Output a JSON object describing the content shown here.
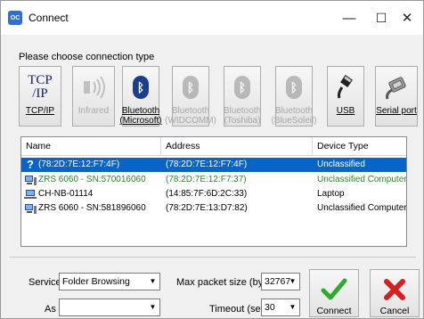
{
  "window": {
    "title": "Connect",
    "icon_text": "OC",
    "minimize_glyph": "—",
    "maximize_glyph": "☐",
    "close_glyph": "✕"
  },
  "prompt": "Please choose connection type",
  "connection_types": [
    {
      "label": "TCP/IP",
      "icon": "tcpip-icon",
      "glyph": "TCP\n/IP",
      "enabled": true
    },
    {
      "label": "Infrared",
      "icon": "infrared-icon",
      "enabled": false
    },
    {
      "label": "Bluetooth\n(Microsoft)",
      "icon": "bluetooth-icon",
      "enabled": true
    },
    {
      "label": "Bluetooth\n(WIDCOMM)",
      "icon": "bluetooth-icon",
      "enabled": false
    },
    {
      "label": "Bluetooth\n(Toshiba)",
      "icon": "bluetooth-icon",
      "enabled": false
    },
    {
      "label": "Bluetooth\n(BlueSoleil)",
      "icon": "bluetooth-icon",
      "enabled": false
    },
    {
      "label": "USB",
      "icon": "usb-icon",
      "enabled": true
    },
    {
      "label": "Serial port",
      "icon": "serial-port-icon",
      "enabled": true
    }
  ],
  "device_list": {
    "columns": [
      "Name",
      "Address",
      "Device Type"
    ],
    "rows": [
      {
        "icon": "question-icon",
        "name": "(78:2D:7E:12:F7:4F)",
        "address": "(78:2D:7E:12:F7:4F)",
        "type": "Unclassified",
        "selected": true,
        "green": false
      },
      {
        "icon": "computer-icon",
        "name": "ZRS 6060 - SN:570016060",
        "address": "(78:2D:7E:12:F7:37)",
        "type": "Unclassified Computer",
        "selected": false,
        "green": true
      },
      {
        "icon": "laptop-icon",
        "name": "CH-NB-01114",
        "address": "(14:85:7F:6D:2C:33)",
        "type": "Laptop",
        "selected": false,
        "green": false
      },
      {
        "icon": "computer-icon",
        "name": "ZRS 6060 - SN:581896060",
        "address": "(78:2D:7E:13:D7:82)",
        "type": "Unclassified Computer",
        "selected": false,
        "green": false
      }
    ]
  },
  "service": {
    "label": "Service",
    "value": "Folder Browsing"
  },
  "as_field": {
    "label": "As",
    "value": ""
  },
  "max_packet": {
    "label": "Max packet size (bytes)",
    "value": "32767"
  },
  "timeout": {
    "label": "Timeout (sec)",
    "value": "30"
  },
  "buttons": {
    "connect": "Connect",
    "cancel": "Cancel"
  },
  "colors": {
    "selection": "#0a64c8",
    "bluetooth": "#1a3f8f",
    "connect_check": "#2faa2f",
    "cancel_x": "#d42020",
    "green_text": "#2a8a2a"
  }
}
